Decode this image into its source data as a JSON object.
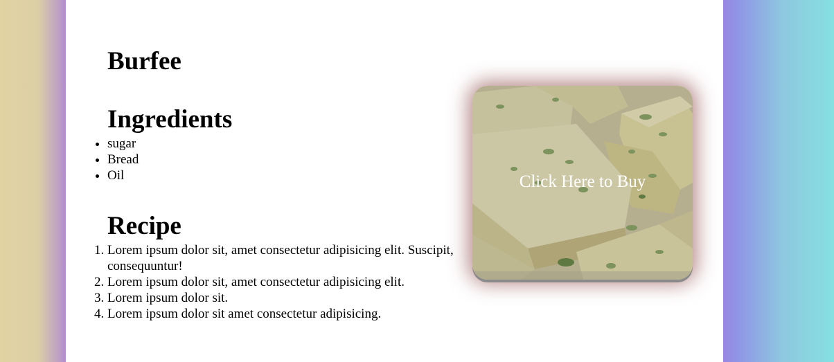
{
  "page": {
    "title": "Burfee",
    "ingredients_heading": "Ingredients",
    "ingredients": [
      "sugar",
      "Bread",
      "Oil"
    ],
    "recipe_heading": "Recipe",
    "recipe_steps": [
      "Lorem ipsum dolor sit, amet consectetur adipisicing elit. Suscipit, consequuntur!",
      "Lorem ipsum dolor sit, amet consectetur adipisicing elit.",
      "Lorem ipsum dolor sit.",
      "Lorem ipsum dolor sit amet consectetur adipisicing."
    ],
    "buy_button_label": "Click Here to Buy"
  },
  "colors": {
    "page_background": "#ffffff",
    "left_gradient": "#e2d3a2",
    "right_gradient": "#85e0e0",
    "card_glow": "#7a2828",
    "button_text": "#ffffff"
  },
  "image": {
    "subject": "burfee-sweet-photo"
  }
}
